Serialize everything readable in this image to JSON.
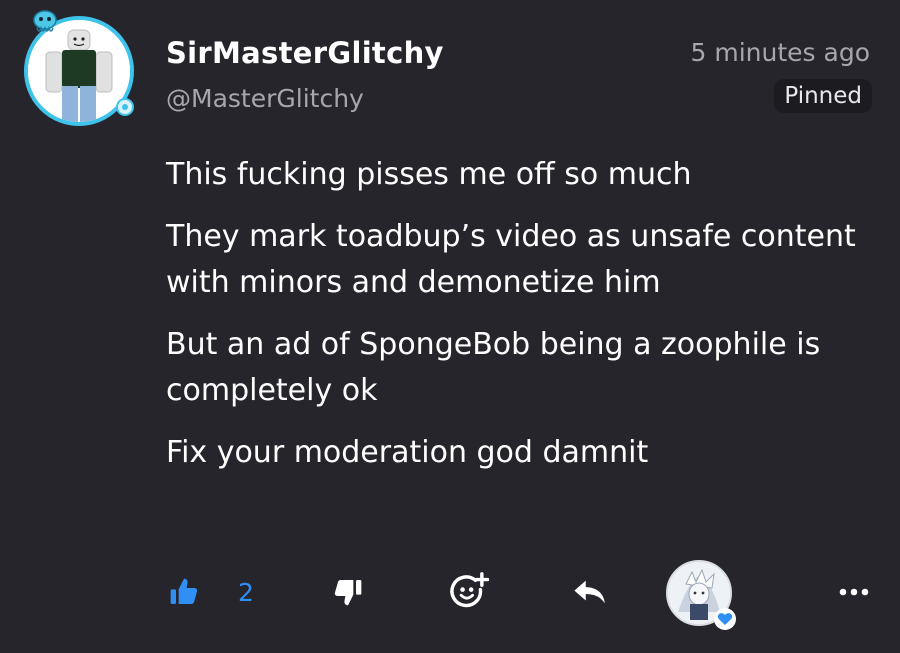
{
  "post": {
    "author": {
      "display_name": "SirMasterGlitchy",
      "handle": "@MasterGlitchy"
    },
    "timestamp": "5 minutes ago",
    "pinned_label": "Pinned",
    "paragraphs": [
      "This fucking pisses me off so much",
      "They mark toadbup’s video as unsafe content with minors and demonetize him",
      "But an ad of SpongeBob being a zoophile is completely ok",
      "Fix your moderation god damnit"
    ]
  },
  "actions": {
    "like_count": "2",
    "icons": {
      "like": "thumbs-up-icon",
      "dislike": "thumbs-down-icon",
      "react": "add-emoji-icon",
      "reply": "reply-arrow-icon",
      "creator_heart": "heart-icon",
      "more": "more-options-icon"
    }
  },
  "colors": {
    "background": "#27252c",
    "text_primary": "#ffffff",
    "text_secondary": "#a7a5ad",
    "accent_blue": "#2f8ff5",
    "avatar_ring": "#3ec3ea",
    "pinned_bg": "#1c1b20"
  }
}
